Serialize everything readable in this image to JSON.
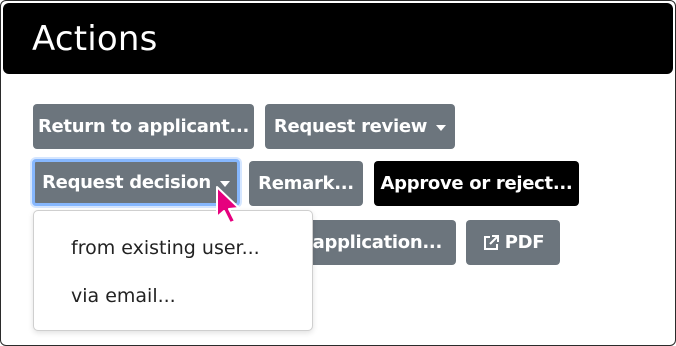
{
  "header": {
    "title": "Actions"
  },
  "buttons": {
    "return_to_applicant": "Return to applicant...",
    "request_review": "Request review",
    "request_decision": "Request decision",
    "remark": "Remark...",
    "approve_or_reject": "Approve or reject...",
    "application_partial": "e application...",
    "pdf": "PDF"
  },
  "dropdown": {
    "items": [
      {
        "label": "from existing user..."
      },
      {
        "label": "via email..."
      }
    ]
  },
  "icons": {
    "caret": "caret-down-icon",
    "external_link": "external-link-icon",
    "cursor": "mouse-pointer-icon"
  },
  "colors": {
    "header_bg": "#000000",
    "button_gray": "#6c757d",
    "button_dark": "#000000",
    "focus_ring": "#86b7fe",
    "cursor": "#e6007e"
  }
}
